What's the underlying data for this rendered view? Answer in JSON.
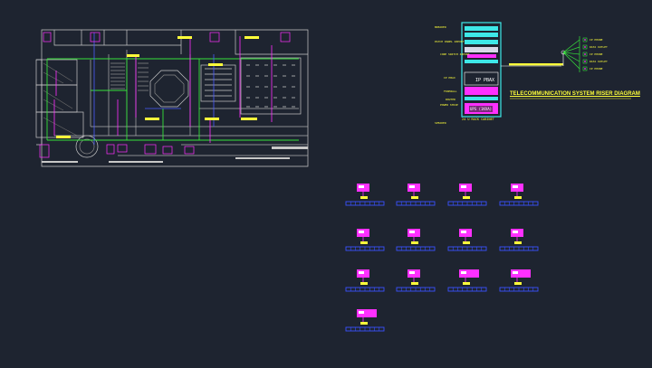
{
  "riser": {
    "title": "TELECOMMUNICATION SYSTEM RISER DIAGRAM",
    "rack_caption": "24 U RACK CABINET",
    "pbax": "IP PBAX",
    "ups": "UPS (1KVA)",
    "rack_labels": [
      "PATCH PANEL 48PORT",
      "CORE SWITCH 48PORT",
      "IP PBAX",
      "FIREWALL",
      "ROUTER",
      "POWER STRIP",
      "SPEAKER",
      "BREAKER"
    ],
    "outlet_labels": [
      "IP PHONE",
      "DATA OUTLET",
      "IP PHONE",
      "DATA OUTLET",
      "IP PHONE"
    ]
  },
  "colors": {
    "background": "#1e2430",
    "wall": "#c8c8c8",
    "cable_green": "#36e23a",
    "accent_magenta": "#ff30ff",
    "annotation_yellow": "#ffff3a",
    "rack_cyan": "#3ee8e8",
    "tray_blue": "#3a52ff"
  },
  "details": {
    "rows": 4,
    "per_row": [
      4,
      4,
      4,
      1
    ]
  }
}
